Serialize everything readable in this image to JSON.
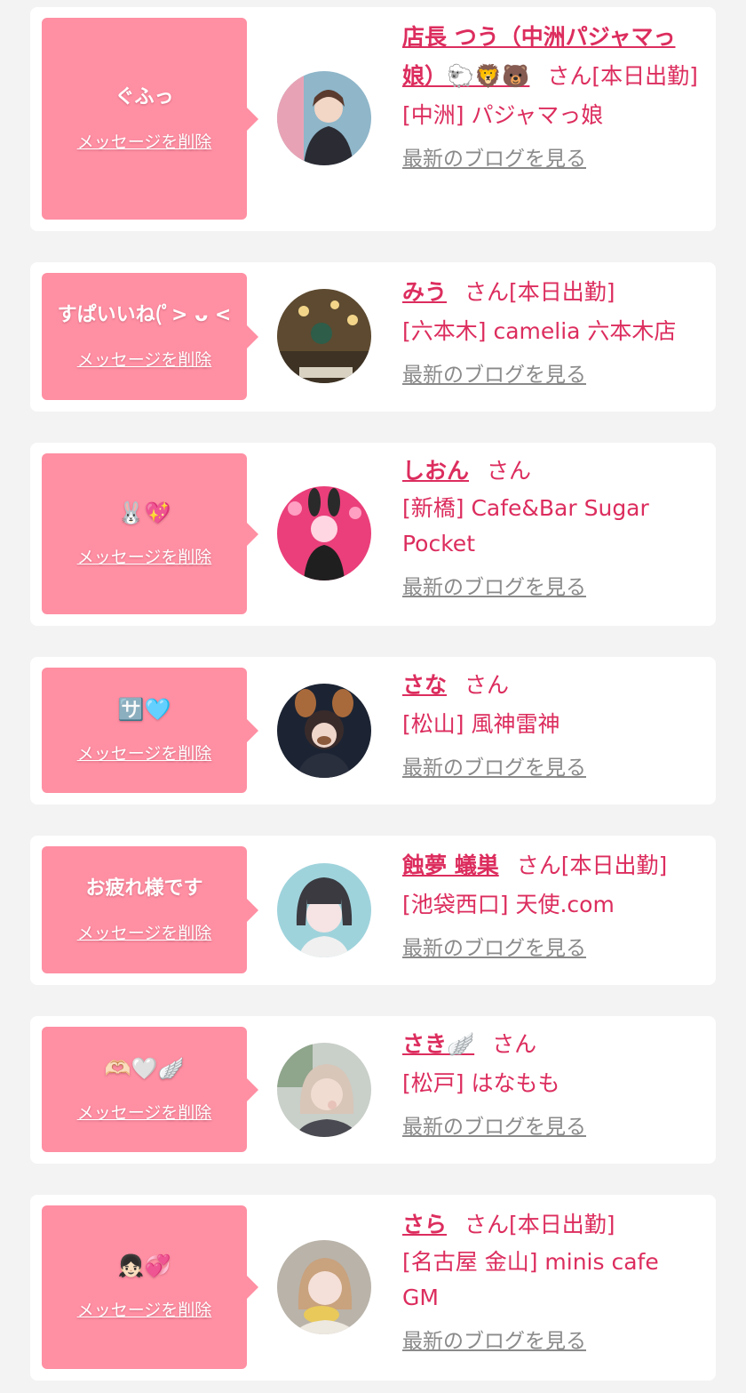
{
  "colors": {
    "page_bg": "#f3f3f3",
    "card_bg": "#ffffff",
    "bubble": "#ff8fa3",
    "accent": "#dc2d5e",
    "muted_link": "#8a8a8a"
  },
  "delete_label": "メッセージを削除",
  "blog_label": "最新のブログを見る",
  "honorific": "さん",
  "entries": [
    {
      "message": "ぐふっ",
      "name": "店長 つう（中洲パジャマっ娘）🐑🦁🐻",
      "status": "[本日出勤]",
      "shop": "[中洲] パジャマっ娘",
      "avatar_icon": "avatar-photo-icon"
    },
    {
      "message": "すぱいいね(ﾟ> ᴗ <",
      "name": "みう",
      "status": "[本日出勤]",
      "shop": "[六本木] camelia 六本木店",
      "avatar_icon": "avatar-photo-icon"
    },
    {
      "message": "🐰💖",
      "name": "しおん",
      "status": "",
      "shop": "[新橋] Cafe&Bar Sugar Pocket",
      "avatar_icon": "avatar-photo-icon"
    },
    {
      "message": "🈂️🩵",
      "name": "さな",
      "status": "",
      "shop": "[松山] 風神雷神",
      "avatar_icon": "avatar-photo-icon"
    },
    {
      "message": "お疲れ様です",
      "name": "蝕夢 蟻巣",
      "status": "[本日出勤]",
      "shop": "[池袋西口] 天使.com",
      "avatar_icon": "avatar-photo-icon"
    },
    {
      "message": "🫶🏻🤍🪽",
      "name": "さき🪽",
      "status": "",
      "shop": "[松戸] はなもも",
      "avatar_icon": "avatar-photo-icon"
    },
    {
      "message": "👧🏻💞",
      "name": "さら",
      "status": "[本日出勤]",
      "shop": "[名古屋 金山] minis cafe GM",
      "avatar_icon": "avatar-photo-icon"
    }
  ]
}
